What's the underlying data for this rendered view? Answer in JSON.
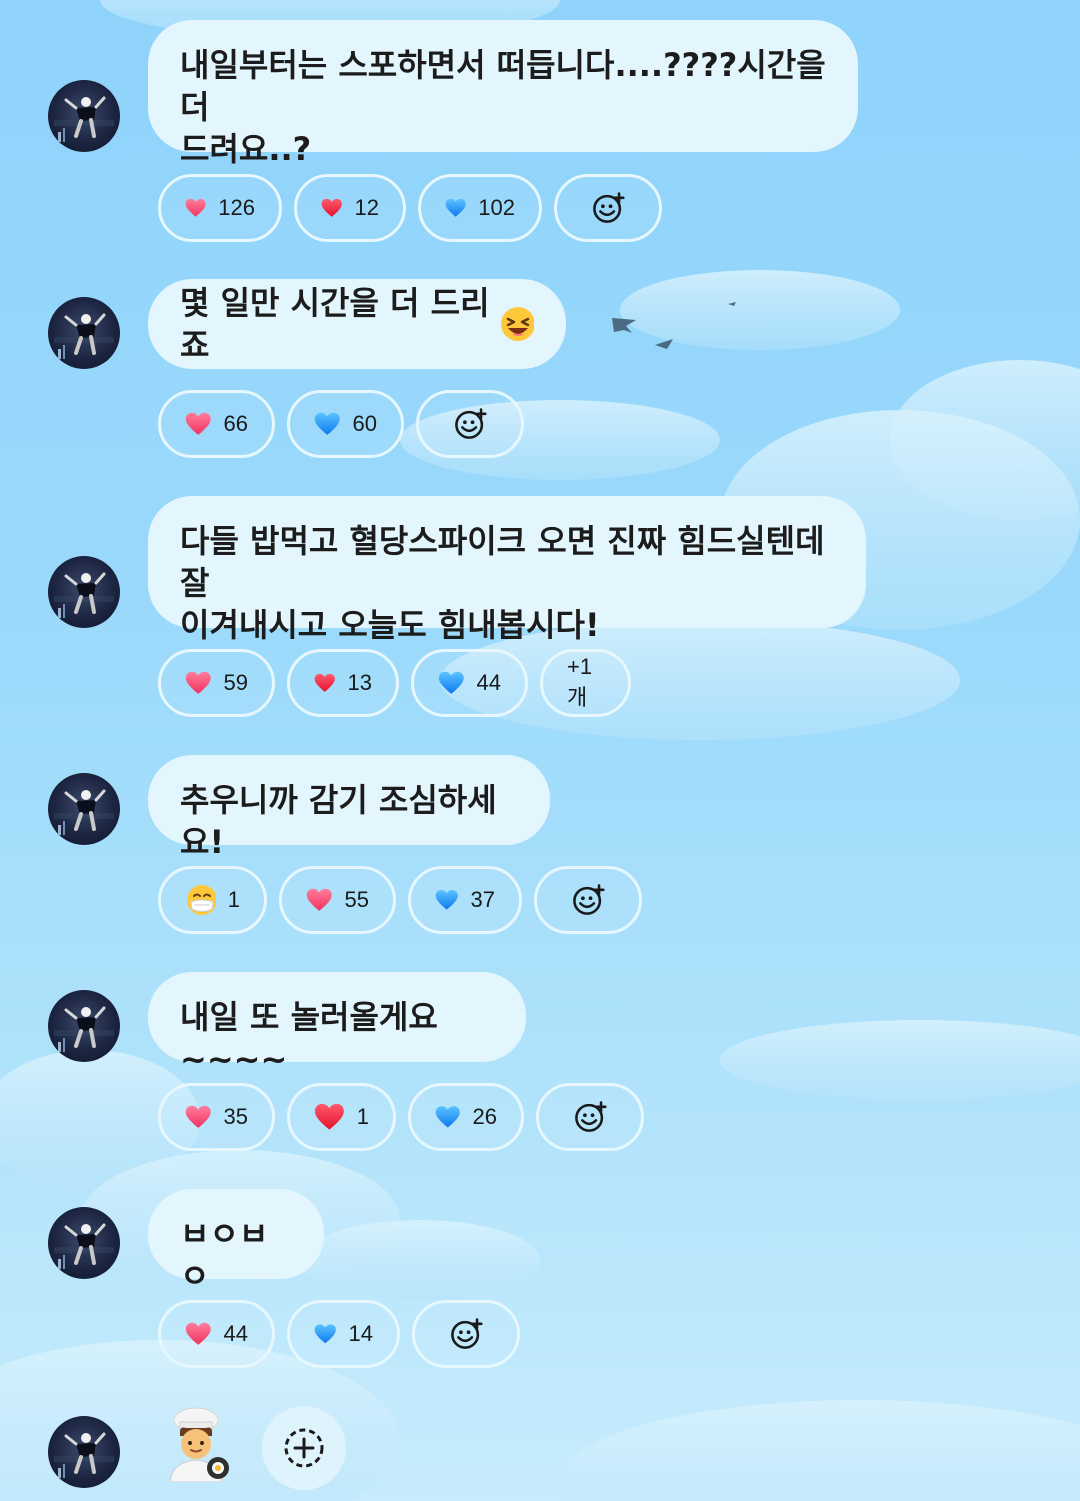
{
  "messages": [
    {
      "text": "내일부터는 스포하면서 떠듭니다....????시간을 더\n드려요..?",
      "reactions": [
        {
          "icon": "pink-heart-icon",
          "count": "126"
        },
        {
          "icon": "red-heart-icon",
          "count": "12"
        },
        {
          "icon": "blue-heart-icon",
          "count": "102"
        }
      ],
      "extra": "add-reaction"
    },
    {
      "text": "몇 일만 시간을 더 드리죠",
      "emoji": "laughing-face-icon",
      "reactions": [
        {
          "icon": "pink-heart-icon",
          "count": "66"
        },
        {
          "icon": "blue-heart-icon",
          "count": "60"
        }
      ],
      "extra": "add-reaction"
    },
    {
      "text": "다들 밥먹고 혈당스파이크 오면 진짜 힘드실텐데 잘\n이겨내시고 오늘도 힘내봅시다!",
      "reactions": [
        {
          "icon": "pink-heart-icon",
          "count": "59"
        },
        {
          "icon": "red-heart-icon",
          "count": "13"
        },
        {
          "icon": "blue-heart-icon",
          "count": "44"
        }
      ],
      "more_label": "+1개"
    },
    {
      "text": "추우니까 감기 조심하세요!",
      "reactions": [
        {
          "icon": "mask-face-icon",
          "count": "1"
        },
        {
          "icon": "pink-heart-icon",
          "count": "55"
        },
        {
          "icon": "blue-heart-icon",
          "count": "37"
        }
      ],
      "extra": "add-reaction"
    },
    {
      "text": "내일 또 놀러올게요~~~~",
      "reactions": [
        {
          "icon": "pink-heart-icon",
          "count": "35"
        },
        {
          "icon": "red-heart-icon",
          "count": "1"
        },
        {
          "icon": "blue-heart-icon",
          "count": "26"
        }
      ],
      "extra": "add-reaction"
    },
    {
      "text": "ㅂㅇㅂㅇ",
      "reactions": [
        {
          "icon": "pink-heart-icon",
          "count": "44"
        },
        {
          "icon": "blue-heart-icon",
          "count": "14"
        }
      ],
      "extra": "add-reaction"
    }
  ],
  "last_message": {
    "emoji": "cook-emoji-icon",
    "extra": "add-reaction-circle"
  },
  "colors": {
    "bubble": "#e3f6fe",
    "pink_heart": "#ff4f7b",
    "red_heart": "#f0243f",
    "blue_heart": "#1e9bff"
  }
}
